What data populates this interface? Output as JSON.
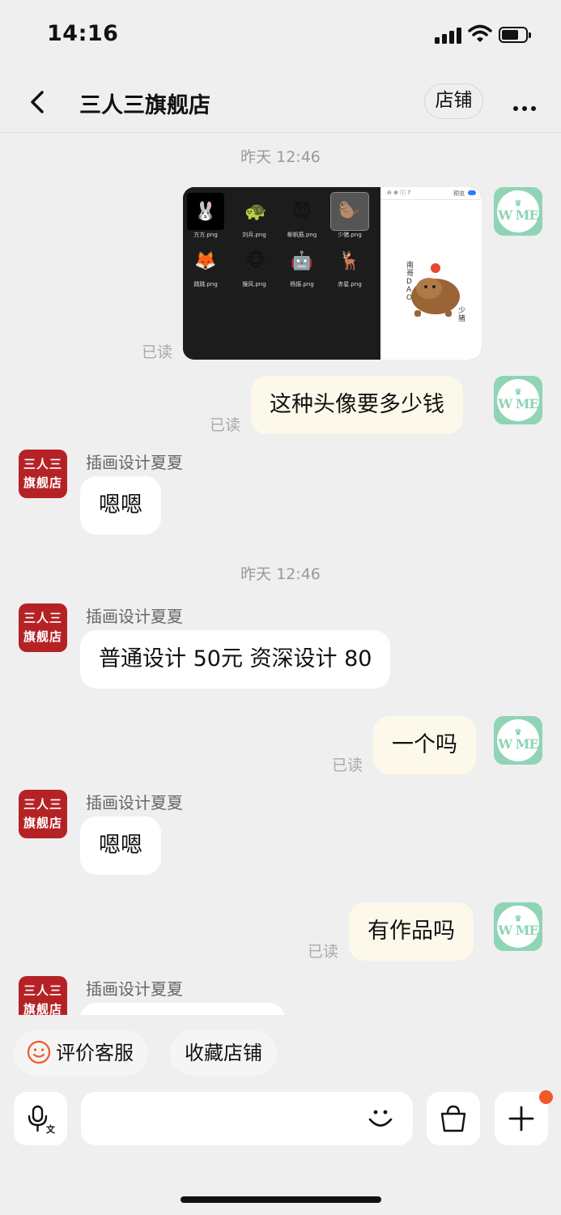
{
  "status": {
    "time": "14:16"
  },
  "nav": {
    "title": "三人三旗舰店",
    "shop_btn": "店铺"
  },
  "chat": {
    "timestamp1": "昨天 12:46",
    "timestamp2": "昨天 12:46",
    "read_label": "已读",
    "shop_sender": "插画设计夏夏",
    "shop_avatar": {
      "line1": "三人三",
      "line2": "旗舰店"
    },
    "my_avatar": {
      "crown": "♛",
      "text": "W ME"
    },
    "image_files": [
      "方方.png",
      "刘兵.png",
      "柳帆筋.png",
      "少猪.png",
      "跳跳.png",
      "猴风.png",
      "杨振.png",
      "赤星.png"
    ],
    "image_caption": "少猪",
    "image_badge": "南哥DAO",
    "image_toolbar": "预览",
    "messages": {
      "m1": "这种头像要多少钱",
      "m2": "嗯嗯",
      "m3": "普通设计 50元 资深设计 80",
      "m4": "一个吗",
      "m5": "嗯嗯",
      "m6": "有作品吗"
    }
  },
  "quick_actions": {
    "rate": "评价客服",
    "favorite": "收藏店铺"
  },
  "colors": {
    "accent": "#f0592a",
    "shop_red": "#b52226",
    "my_avatar": "#8fd4b5",
    "my_bubble": "#fdf9ea"
  },
  "icons": [
    "back-icon",
    "more-icon",
    "voice-icon",
    "emoji-icon",
    "bag-icon",
    "plus-icon",
    "smile-icon"
  ]
}
